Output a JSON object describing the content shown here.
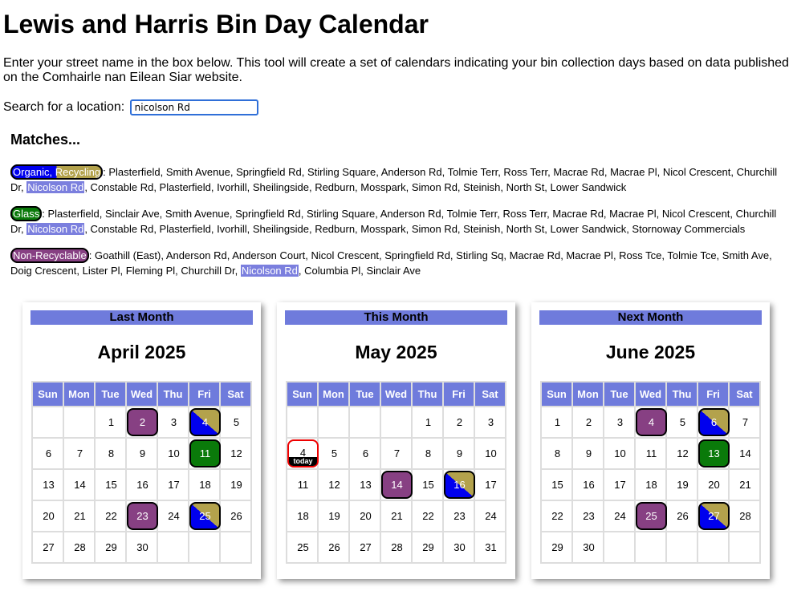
{
  "page": {
    "title": "Lewis and Harris Bin Day Calendar",
    "intro": "Enter your street name in the box below. This tool will create a set of calendars indicating your bin collection days based on data published on the Comhairle nan Eilean Siar website.",
    "search_label": "Search for a location:",
    "search_value": "nicolson Rd"
  },
  "matches": {
    "heading": "Matches...",
    "groups": [
      {
        "label": "Organic, Recycling",
        "type": "or",
        "before": ": Plasterfield, Smith Avenue, Springfield Rd, Stirling Square, Anderson Rd, Tolmie Terr, Ross Terr, Macrae Rd, Macrae Pl, Nicol Crescent, Churchill Dr, ",
        "highlight": "Nicolson Rd",
        "after": ", Constable Rd, Plasterfield, Ivorhill, Sheilingside, Redburn, Mosspark, Simon Rd, Steinish, North St, Lower Sandwick"
      },
      {
        "label": "Glass",
        "type": "gl",
        "before": ": Plasterfield, Sinclair Ave, Smith Avenue, Springfield Rd, Stirling Square, Anderson Rd, Tolmie Terr, Ross Terr, Macrae Rd, Macrae Pl, Nicol Crescent, Churchill Dr, ",
        "highlight": "Nicolson Rd",
        "after": ", Constable Rd, Plasterfield, Ivorhill, Sheilingside, Redburn, Mosspark, Simon Rd, Steinish, North St, Lower Sandwick, Stornoway Commercials"
      },
      {
        "label": "Non-Recyclable",
        "type": "nr",
        "before": ": Goathill (East), Anderson Rd, Anderson Court, Nicol Crescent, Springfield Rd, Stirling Sq, Macrae Rd, Macrae Pl, Ross Tce, Tolmie Tce, Smith Ave, Doig Crescent, Lister Pl, Fleming Pl, Churchill Dr, ",
        "highlight": "Nicolson Rd",
        "after": ", Columbia Pl, Sinclair Ave"
      }
    ]
  },
  "weekdays": [
    "Sun",
    "Mon",
    "Tue",
    "Wed",
    "Thu",
    "Fri",
    "Sat"
  ],
  "today_label": "today",
  "colors": {
    "header": "#6f7bdc",
    "non_recyclable": "#874083",
    "glass": "#0a7a0a",
    "organic": "#0000ee",
    "recycling": "#b3a24c",
    "highlight": "#7b7fde",
    "today_border": "#e00000"
  },
  "calendars": [
    {
      "heading": "Last Month",
      "title": "April 2025",
      "weeks": [
        [
          null,
          null,
          1,
          2,
          3,
          4,
          5
        ],
        [
          6,
          7,
          8,
          9,
          10,
          11,
          12
        ],
        [
          13,
          14,
          15,
          16,
          17,
          18,
          19
        ],
        [
          20,
          21,
          22,
          23,
          24,
          25,
          26
        ],
        [
          27,
          28,
          29,
          30,
          null,
          null,
          null
        ]
      ],
      "marks": {
        "2": "nr",
        "4": "or",
        "11": "gl",
        "23": "nr",
        "25": "or"
      }
    },
    {
      "heading": "This Month",
      "title": "May 2025",
      "weeks": [
        [
          null,
          null,
          null,
          null,
          1,
          2,
          3
        ],
        [
          4,
          5,
          6,
          7,
          8,
          9,
          10
        ],
        [
          11,
          12,
          13,
          14,
          15,
          16,
          17
        ],
        [
          18,
          19,
          20,
          21,
          22,
          23,
          24
        ],
        [
          25,
          26,
          27,
          28,
          29,
          30,
          31
        ]
      ],
      "marks": {
        "4": "today",
        "14": "nr",
        "16": "or"
      }
    },
    {
      "heading": "Next Month",
      "title": "June 2025",
      "weeks": [
        [
          1,
          2,
          3,
          4,
          5,
          6,
          7
        ],
        [
          8,
          9,
          10,
          11,
          12,
          13,
          14
        ],
        [
          15,
          16,
          17,
          18,
          19,
          20,
          21
        ],
        [
          22,
          23,
          24,
          25,
          26,
          27,
          28
        ],
        [
          29,
          30,
          null,
          null,
          null,
          null,
          null
        ]
      ],
      "marks": {
        "4": "nr",
        "6": "or",
        "13": "gl",
        "25": "nr",
        "27": "or"
      }
    }
  ]
}
